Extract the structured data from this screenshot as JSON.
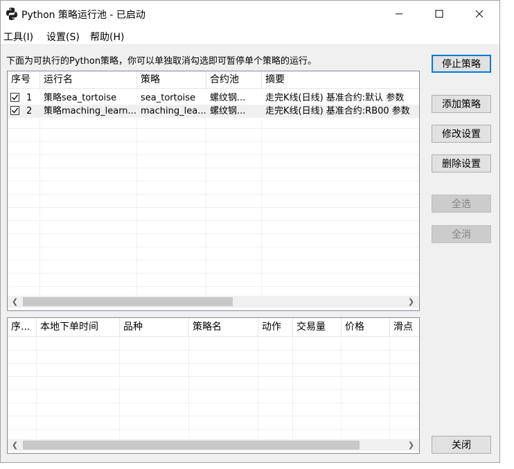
{
  "window": {
    "title": "Python 策略运行池 - 已启动",
    "icons": {
      "app": "python-icon",
      "minimize": "minimize-icon",
      "maximize": "maximize-icon",
      "close": "close-icon"
    }
  },
  "menu": {
    "tools": "工具(I)",
    "settings": "设置(S)",
    "help": "帮助(H)"
  },
  "instruction": "下面为可执行的Python策略，你可以单独取消勾选即可暂停单个策略的运行。",
  "strategy_table": {
    "columns": [
      "序号",
      "运行名",
      "策略",
      "合约池",
      "摘要"
    ],
    "rows": [
      {
        "checked": true,
        "index": "1",
        "run_name": "策略sea_tortoise",
        "strategy": "sea_tortoise",
        "contract_pool": "螺纹钢...",
        "summary": "走完K线(日线) 基准合约:默认 参数"
      },
      {
        "checked": true,
        "index": "2",
        "run_name": "策略maching_learn...",
        "strategy": "maching_lea...",
        "contract_pool": "螺纹钢...",
        "summary": "走完K线(日线) 基准合约:RB00 参数"
      }
    ]
  },
  "order_table": {
    "columns": [
      "序...",
      "本地下单时间",
      "品种",
      "策略名",
      "动作",
      "交易量",
      "价格",
      "滑点"
    ]
  },
  "buttons": {
    "stop": "停止策略",
    "add": "添加策略",
    "modify": "修改设置",
    "delete": "删除设置",
    "select_all": "全选",
    "deselect_all": "全消",
    "close": "关闭"
  }
}
